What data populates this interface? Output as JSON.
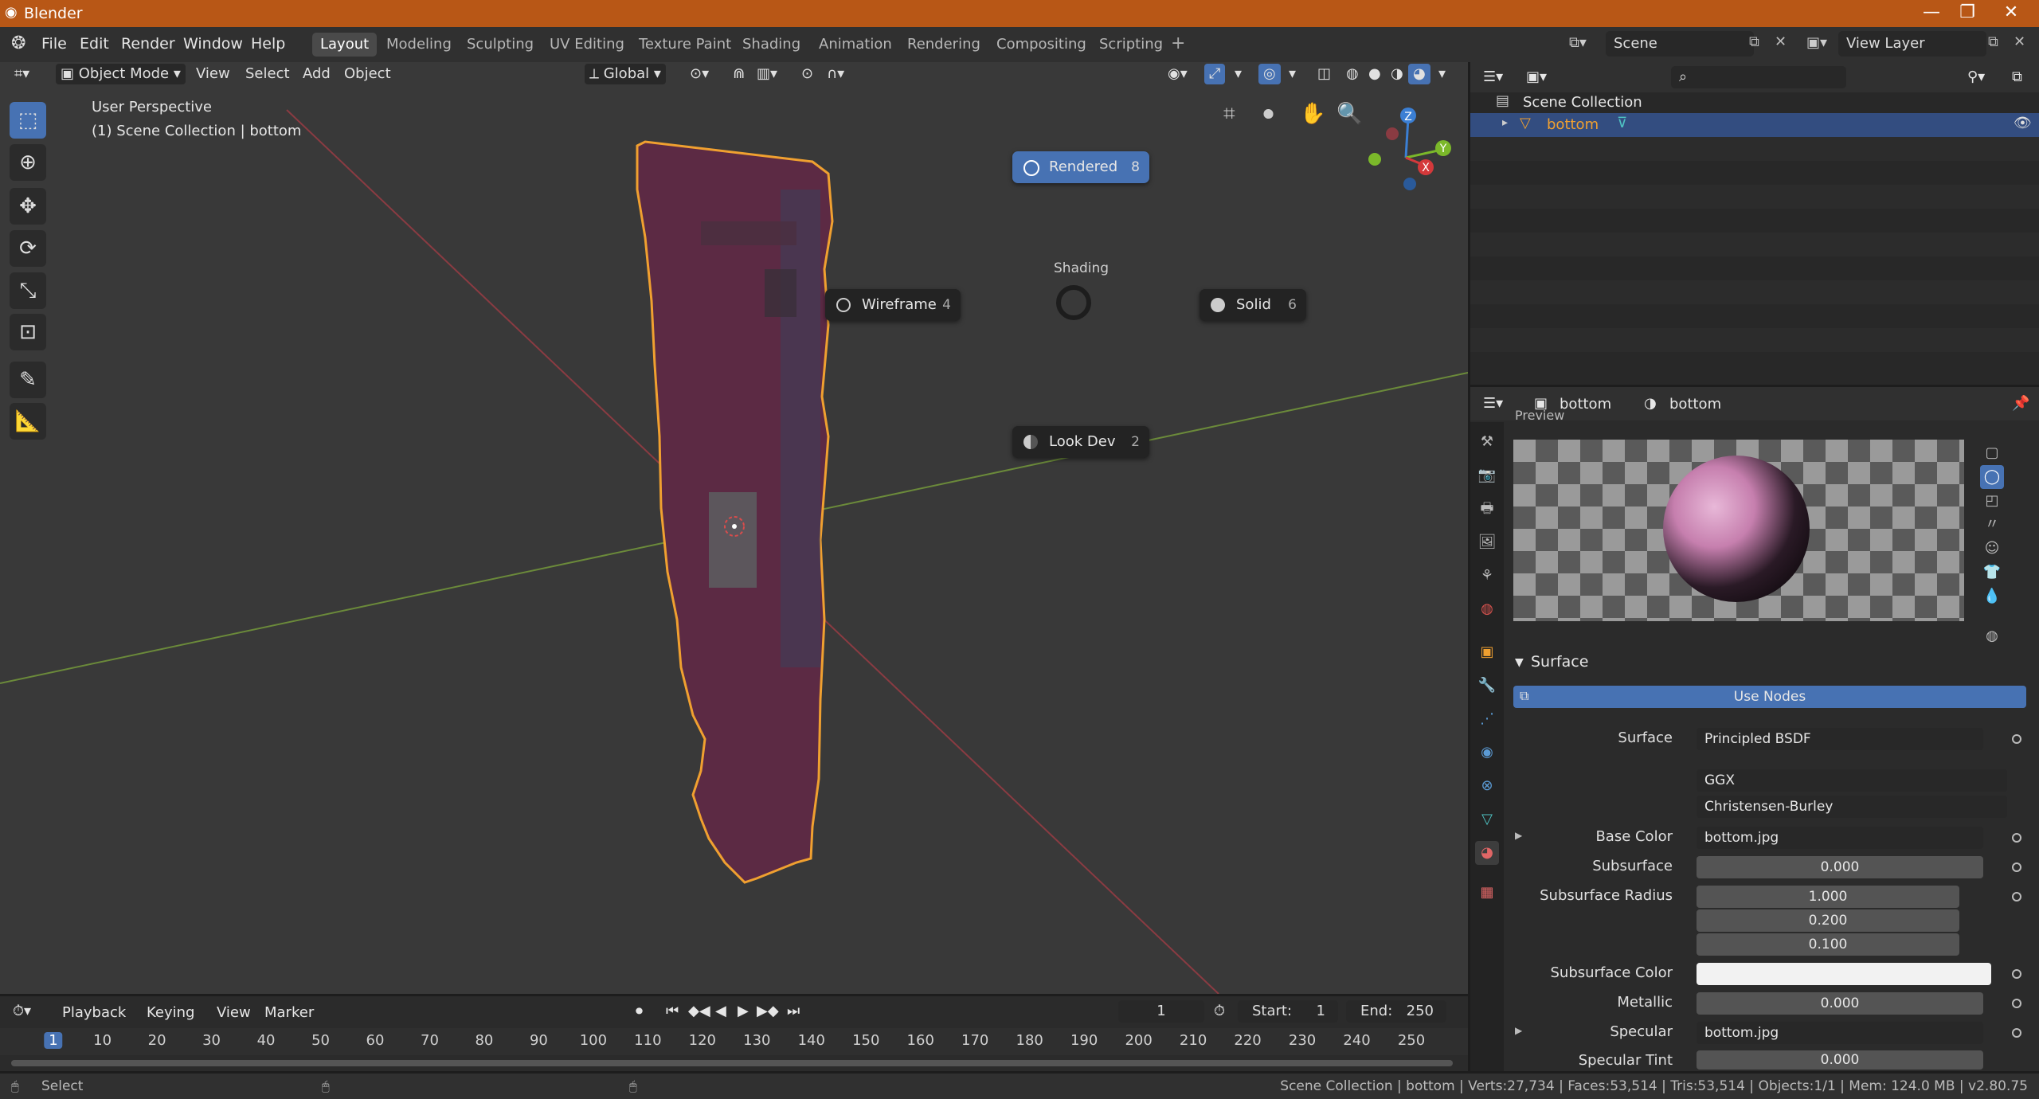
{
  "window": {
    "title": "Blender",
    "controls": [
      "—",
      "❐",
      "✕"
    ]
  },
  "menu": [
    "File",
    "Edit",
    "Render",
    "Window",
    "Help"
  ],
  "workspaces": [
    {
      "label": "Layout",
      "active": true
    },
    {
      "label": "Modeling"
    },
    {
      "label": "Sculpting"
    },
    {
      "label": "UV Editing"
    },
    {
      "label": "Texture Paint"
    },
    {
      "label": "Shading"
    },
    {
      "label": "Animation"
    },
    {
      "label": "Rendering"
    },
    {
      "label": "Compositing"
    },
    {
      "label": "Scripting"
    }
  ],
  "top_right": {
    "scene": "Scene",
    "view_layer": "View Layer"
  },
  "viewport_header": {
    "mode": "Object Mode",
    "menus": [
      "View",
      "Select",
      "Add",
      "Object"
    ],
    "orientation": "Global"
  },
  "viewport_overlay": {
    "perspective": "User Perspective",
    "collection": "(1) Scene Collection | bottom"
  },
  "pie_menu": {
    "title": "Shading",
    "items": [
      {
        "label": "Rendered",
        "key": "8",
        "active": true
      },
      {
        "label": "Wireframe",
        "key": "4"
      },
      {
        "label": "Solid",
        "key": "6"
      },
      {
        "label": "Look Dev",
        "key": "2"
      }
    ]
  },
  "gizmo": {
    "x": "X",
    "y": "Y",
    "z": "Z"
  },
  "outliner": {
    "root": "Scene Collection",
    "items": [
      {
        "label": "bottom",
        "selected": true
      }
    ]
  },
  "properties": {
    "header": {
      "object": "bottom",
      "material": "bottom"
    },
    "preview_label": "Preview",
    "surface_panel": "Surface",
    "use_nodes": "Use Nodes",
    "rows": [
      {
        "label": "Surface",
        "value": "Principled BSDF"
      },
      {
        "label": "",
        "value": "GGX"
      },
      {
        "label": "",
        "value": "Christensen-Burley"
      },
      {
        "label": "Base Color",
        "value": "bottom.jpg"
      },
      {
        "label": "Subsurface",
        "value": "0.000"
      },
      {
        "label": "Subsurface Radius",
        "values": [
          "1.000",
          "0.200",
          "0.100"
        ]
      },
      {
        "label": "Subsurface Color",
        "value": ""
      },
      {
        "label": "Metallic",
        "value": "0.000"
      },
      {
        "label": "Specular",
        "value": "bottom.jpg"
      },
      {
        "label": "Specular Tint",
        "value": "0.000"
      }
    ]
  },
  "timeline": {
    "menus": [
      "Playback",
      "Keying",
      "View",
      "Marker"
    ],
    "current_frame": "1",
    "start_label": "Start:",
    "start": "1",
    "end_label": "End:",
    "end": "250",
    "ticks": [
      "1",
      "10",
      "20",
      "30",
      "40",
      "50",
      "60",
      "70",
      "80",
      "90",
      "100",
      "110",
      "120",
      "130",
      "140",
      "150",
      "160",
      "170",
      "180",
      "190",
      "200",
      "210",
      "220",
      "230",
      "240",
      "250"
    ]
  },
  "status": {
    "left": "Select",
    "right": "Scene Collection | bottom | Verts:27,734 | Faces:53,514 | Tris:53,514 | Objects:1/1 | Mem: 124.0 MB | v2.80.75"
  },
  "colors": {
    "accent": "#4772b3",
    "titlebar": "#b85716",
    "selection_outline": "#f0a030"
  }
}
